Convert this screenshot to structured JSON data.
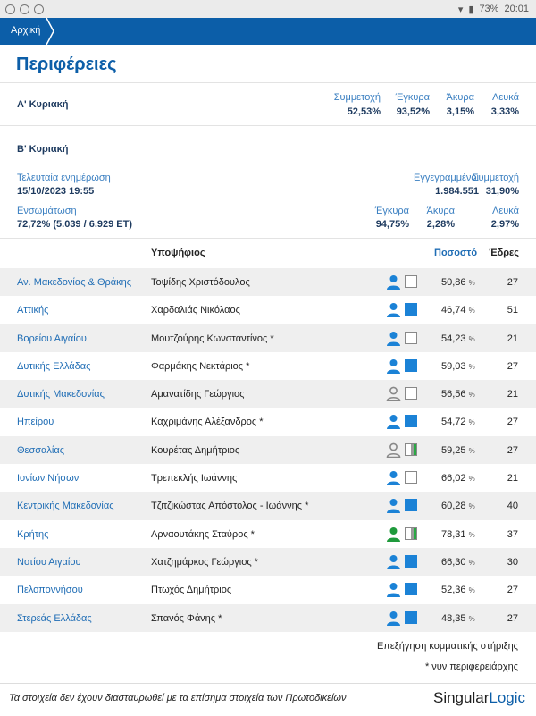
{
  "status": {
    "battery": "73%",
    "time": "20:01"
  },
  "nav": {
    "breadcrumb": "Αρχική"
  },
  "page_title": "Περιφέρειες",
  "round_a": {
    "label": "Α' Κυριακή",
    "stats": [
      {
        "header": "Συμμετοχή",
        "value": "52,53%"
      },
      {
        "header": "Έγκυρα",
        "value": "93,52%"
      },
      {
        "header": "Άκυρα",
        "value": "3,15%"
      },
      {
        "header": "Λευκά",
        "value": "3,33%"
      }
    ]
  },
  "round_b": {
    "label": "Β' Κυριακή",
    "last_update_label": "Τελευταία ενημέρωση",
    "last_update_value": "15/10/2023 19:55",
    "registered_label": "Εγγεγραμμένοι",
    "registered_value": "1.984.551",
    "turnout_label": "Συμμετοχή",
    "turnout_value": "31,90%",
    "counted_label": "Ενσωμάτωση",
    "counted_value": "72,72% (5.039 / 6.929 ΕΤ)",
    "valid_label": "Έγκυρα",
    "valid_value": "94,75%",
    "invalid_label": "Άκυρα",
    "invalid_value": "2,28%",
    "blank_label": "Λευκά",
    "blank_value": "2,97%"
  },
  "table": {
    "headers": {
      "candidate": "Υποψήφιος",
      "percent": "Ποσοστό",
      "seats": "Έδρες"
    },
    "pct_unit": "%",
    "rows": [
      {
        "region": "Αν. Μακεδονίας & Θράκης",
        "candidate": "Τοψίδης Χριστόδουλος",
        "percent": "50,86",
        "seats": "27",
        "person": "blue",
        "box": "white"
      },
      {
        "region": "Αττικής",
        "candidate": "Χαρδαλιάς Νικόλαος",
        "percent": "46,74",
        "seats": "51",
        "person": "blue",
        "box": "blue"
      },
      {
        "region": "Βορείου Αιγαίου",
        "candidate": "Μουτζούρης Κωνσταντίνος *",
        "percent": "54,23",
        "seats": "21",
        "person": "blue",
        "box": "white"
      },
      {
        "region": "Δυτικής Ελλάδας",
        "candidate": "Φαρμάκης Νεκτάριος *",
        "percent": "59,03",
        "seats": "27",
        "person": "blue",
        "box": "blue"
      },
      {
        "region": "Δυτικής Μακεδονίας",
        "candidate": "Αμανατίδης Γεώργιος",
        "percent": "56,56",
        "seats": "21",
        "person": "gray",
        "box": "white"
      },
      {
        "region": "Ηπείρου",
        "candidate": "Καχριμάνης Αλέξανδρος *",
        "percent": "54,72",
        "seats": "27",
        "person": "blue",
        "box": "blue"
      },
      {
        "region": "Θεσσαλίας",
        "candidate": "Κουρέτας Δημήτριος",
        "percent": "59,25",
        "seats": "27",
        "person": "gray",
        "box": "split"
      },
      {
        "region": "Ιονίων Νήσων",
        "candidate": "Τρεπεκλής Ιωάννης",
        "percent": "66,02",
        "seats": "21",
        "person": "blue",
        "box": "white"
      },
      {
        "region": "Κεντρικής Μακεδονίας",
        "candidate": "Τζιτζικώστας Απόστολος - Ιωάννης *",
        "percent": "60,28",
        "seats": "40",
        "person": "blue",
        "box": "blue"
      },
      {
        "region": "Κρήτης",
        "candidate": "Αρναουτάκης Σταύρος *",
        "percent": "78,31",
        "seats": "37",
        "person": "green",
        "box": "split"
      },
      {
        "region": "Νοτίου Αιγαίου",
        "candidate": "Χατζημάρκος Γεώργιος *",
        "percent": "66,30",
        "seats": "30",
        "person": "blue",
        "box": "blue"
      },
      {
        "region": "Πελοποννήσου",
        "candidate": "Πτωχός Δημήτριος",
        "percent": "52,36",
        "seats": "27",
        "person": "blue",
        "box": "blue"
      },
      {
        "region": "Στερεάς Ελλάδας",
        "candidate": "Σπανός Φάνης *",
        "percent": "48,35",
        "seats": "27",
        "person": "blue",
        "box": "blue"
      }
    ]
  },
  "links": {
    "party_support": "Επεξήγηση κομματικής στήριξης",
    "footnote": "* νυν περιφερειάρχης"
  },
  "footer": {
    "disclaimer": "Τα στοιχεία δεν έχουν διασταυρωθεί με τα επίσημα στοιχεία των Πρωτοδικείων",
    "logo_a": "Singular",
    "logo_b": "Logic"
  },
  "colors": {
    "accent": "#0c5ea8",
    "blue": "#1b82d6",
    "person_blue": "#1b82d6",
    "person_gray": "#888888",
    "person_green": "#1f9a3c"
  }
}
